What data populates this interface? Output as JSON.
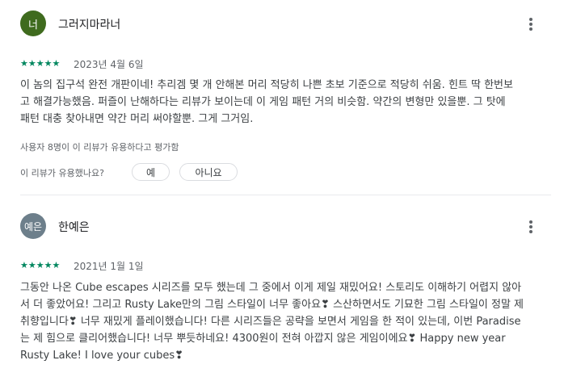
{
  "colors": {
    "star": "#01875f",
    "avatar1": "#3f6b1e",
    "avatar2": "#6d7f8b"
  },
  "icons": {
    "more": "more-vert-icon",
    "star": "star-icon"
  },
  "reviews": [
    {
      "avatar_text": "너",
      "name": "그러지마라너",
      "stars": "★★★★★",
      "rating": 5,
      "date": "2023년 4월 6일",
      "lines": [
        "이 놈의 집구석 완전 개판이네! 추리겜 몇 개 안해본 머리 적당히 나쁜 초보 기준으로 적당히 쉬움. 힌트 딱 한번보",
        "고 해결가능했음. 퍼즐이 난해하다는 리뷰가 보이는데 이 게임 패턴 거의 비슷함. 약간의 변형만 있을뿐. 그 탓에",
        "패턴 대충 찾아내면 약간 머리 써야할뿐. 그게 그거임."
      ],
      "helpful_count": "사용자 8명이 이 리뷰가 유용하다고 평가함",
      "helpful_question": "이 리뷰가 유용했나요?",
      "yes_label": "예",
      "no_label": "아니요"
    },
    {
      "avatar_text": "예은",
      "name": "한예은",
      "stars": "★★★★★",
      "rating": 5,
      "date": "2021년 1월 1일",
      "lines": [
        "그동안 나온 Cube escapes 시리즈를 모두 했는데 그 중에서 이게 제일 재밌어요! 스토리도 이해하기 어렵지 않아",
        "서 더 좋았어요! 그리고 Rusty Lake만의 그림 스타일이 너무 좋아요❣ 스산하면서도 기묘한 그림 스타일이 정말 제",
        "취향입니다❣ 너무 재밌게 플레이했습니다! 다른 시리즈들은 공략을 보면서 게임을 한 적이 있는데, 이번 Paradise",
        "는 제 힘으로 클리어했습니다! 너무 뿌듯하네요! 4300원이 전혀 아깝지 않은 게임이에요❣ Happy new year",
        "Rusty Lake! I love your cubes❣"
      ]
    }
  ]
}
